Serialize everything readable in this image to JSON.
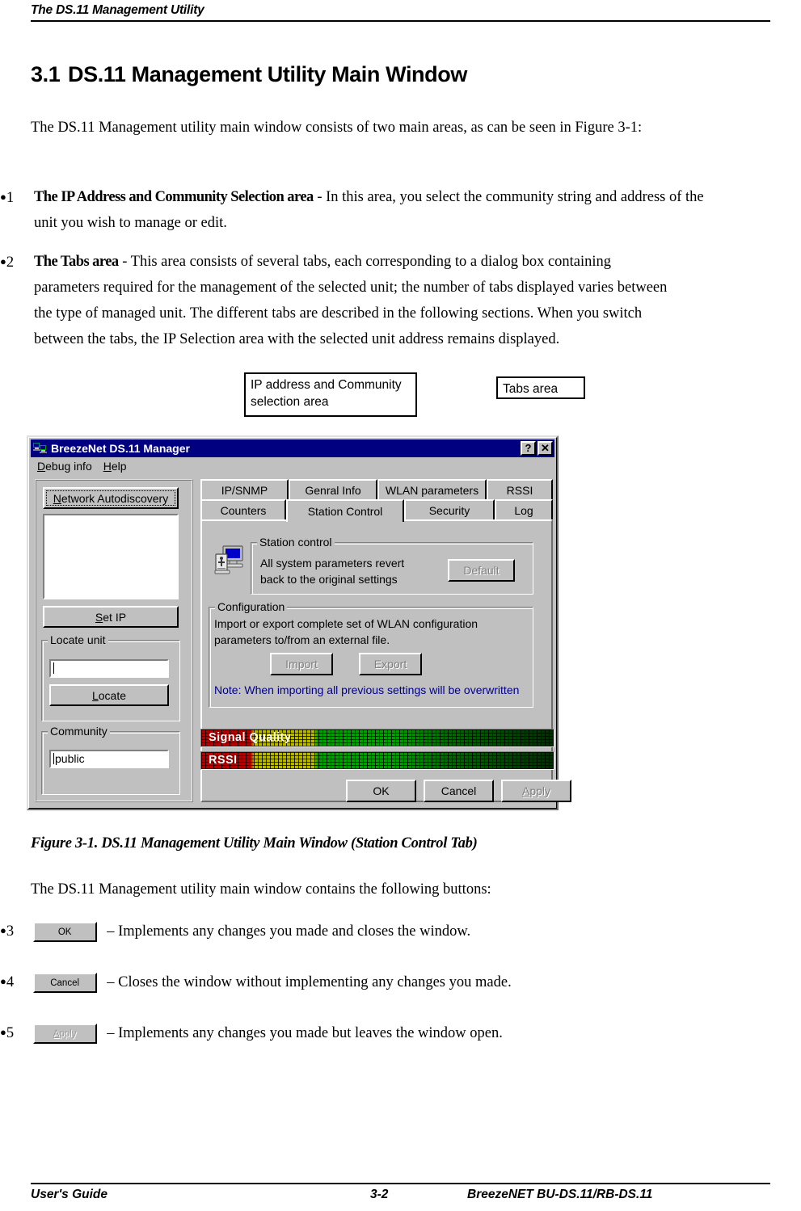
{
  "page_header": {
    "title": "The DS.11 Management Utility"
  },
  "section": {
    "number": "3.1",
    "title": "DS.11 Management Utility Main Window"
  },
  "paragraphs": {
    "intro": "The DS.11 Management utility main window consists of two main areas, as can be seen in Figure 3-1:",
    "buttons_intro": "The DS.11 Management utility main window contains the following buttons:"
  },
  "bullets": [
    {
      "marker": "1",
      "bold_lead": "The IP Address and Community Selection area",
      "text": " - In this area, you select the community string and address of the unit you wish to manage or edit."
    },
    {
      "marker": "2",
      "bold_lead": "The Tabs area",
      "text": " - This area consists of several tabs, each corresponding to a dialog box containing parameters required for the management of the selected unit; the number of tabs displayed varies between the type of managed unit. The different tabs are described in the following sections. When you switch between the tabs, the IP Selection area with the selected unit address remains displayed."
    }
  ],
  "callouts": {
    "ip_area": "IP address and Community selection area",
    "tabs_area": "Tabs area"
  },
  "figure": {
    "caption": "Figure 3-1.  DS.11 Management Utility Main Window (Station Control Tab)"
  },
  "button_bullets": [
    {
      "marker": "3",
      "button_label": "OK",
      "button_state": "enabled",
      "description": "– Implements any changes you made and closes the window."
    },
    {
      "marker": "4",
      "button_label": "Cancel",
      "button_state": "enabled",
      "description": "– Closes the window without implementing any changes you made."
    },
    {
      "marker": "5",
      "button_label": "Apply",
      "button_state": "disabled",
      "description": "– Implements any changes you made but leaves the window open."
    }
  ],
  "app_window": {
    "title": "BreezeNet DS.11 Manager",
    "title_icon": "network-computers-icon",
    "titlebar_buttons": [
      {
        "name": "help-button",
        "glyph": "?"
      },
      {
        "name": "close-button",
        "glyph": "✕"
      }
    ],
    "menu": [
      {
        "label": "Debug info",
        "accel": "D"
      },
      {
        "label": "Help",
        "accel": "H"
      }
    ],
    "left_panel": {
      "autodiscovery_button": {
        "label": "Network Autodiscovery",
        "accel": "N",
        "focused": true
      },
      "device_list": {
        "items": [],
        "value": ""
      },
      "set_ip_button": {
        "label": "Set IP",
        "accel": "S"
      },
      "locate_unit": {
        "group_title": "Locate unit",
        "input_value": "",
        "locate_button": {
          "label": "Locate",
          "accel": "L"
        }
      },
      "community": {
        "group_title": "Community",
        "input_value": "public"
      }
    },
    "tabs": {
      "row1": [
        {
          "label": "IP/SNMP",
          "active": false
        },
        {
          "label": "Genral Info",
          "active": false
        },
        {
          "label": "WLAN parameters",
          "active": false
        },
        {
          "label": "RSSI",
          "active": false
        }
      ],
      "row2": [
        {
          "label": "Counters",
          "active": false
        },
        {
          "label": "Station Control",
          "active": true
        },
        {
          "label": "Security",
          "active": false
        },
        {
          "label": "Log",
          "active": false
        }
      ]
    },
    "station_control_page": {
      "page_icon": "station-computer-icon",
      "station_control_group": {
        "title": "Station control",
        "description": "All system parameters revert back to the original settings",
        "default_button": {
          "label": "Default",
          "state": "disabled"
        }
      },
      "configuration_group": {
        "title": "Configuration",
        "description": "Import or export complete set of WLAN configuration parameters to/from an external file.",
        "import_button": {
          "label": "Import",
          "state": "disabled"
        },
        "export_button": {
          "label": "Export",
          "state": "disabled"
        },
        "note": "Note: When importing all previous settings will be overwritten",
        "note_color": "#00008b"
      }
    },
    "meters": [
      {
        "label": "Signal Quality",
        "name": "signal-quality-meter"
      },
      {
        "label": "RSSI",
        "name": "rssi-meter"
      }
    ],
    "dialog_buttons": [
      {
        "label": "OK",
        "state": "enabled"
      },
      {
        "label": "Cancel",
        "state": "enabled"
      },
      {
        "label": "Apply",
        "state": "disabled",
        "accel": "A"
      }
    ]
  },
  "footer": {
    "left": "User's Guide",
    "page": "3-2",
    "right": "BreezeNET BU-DS.11/RB-DS.11"
  },
  "colors": {
    "titlebar": "#000080",
    "face": "#c0c0c0",
    "note_blue": "#00008b",
    "meter_red": "#b40000",
    "meter_yellow": "#b8b800",
    "meter_green": "#00a000"
  }
}
